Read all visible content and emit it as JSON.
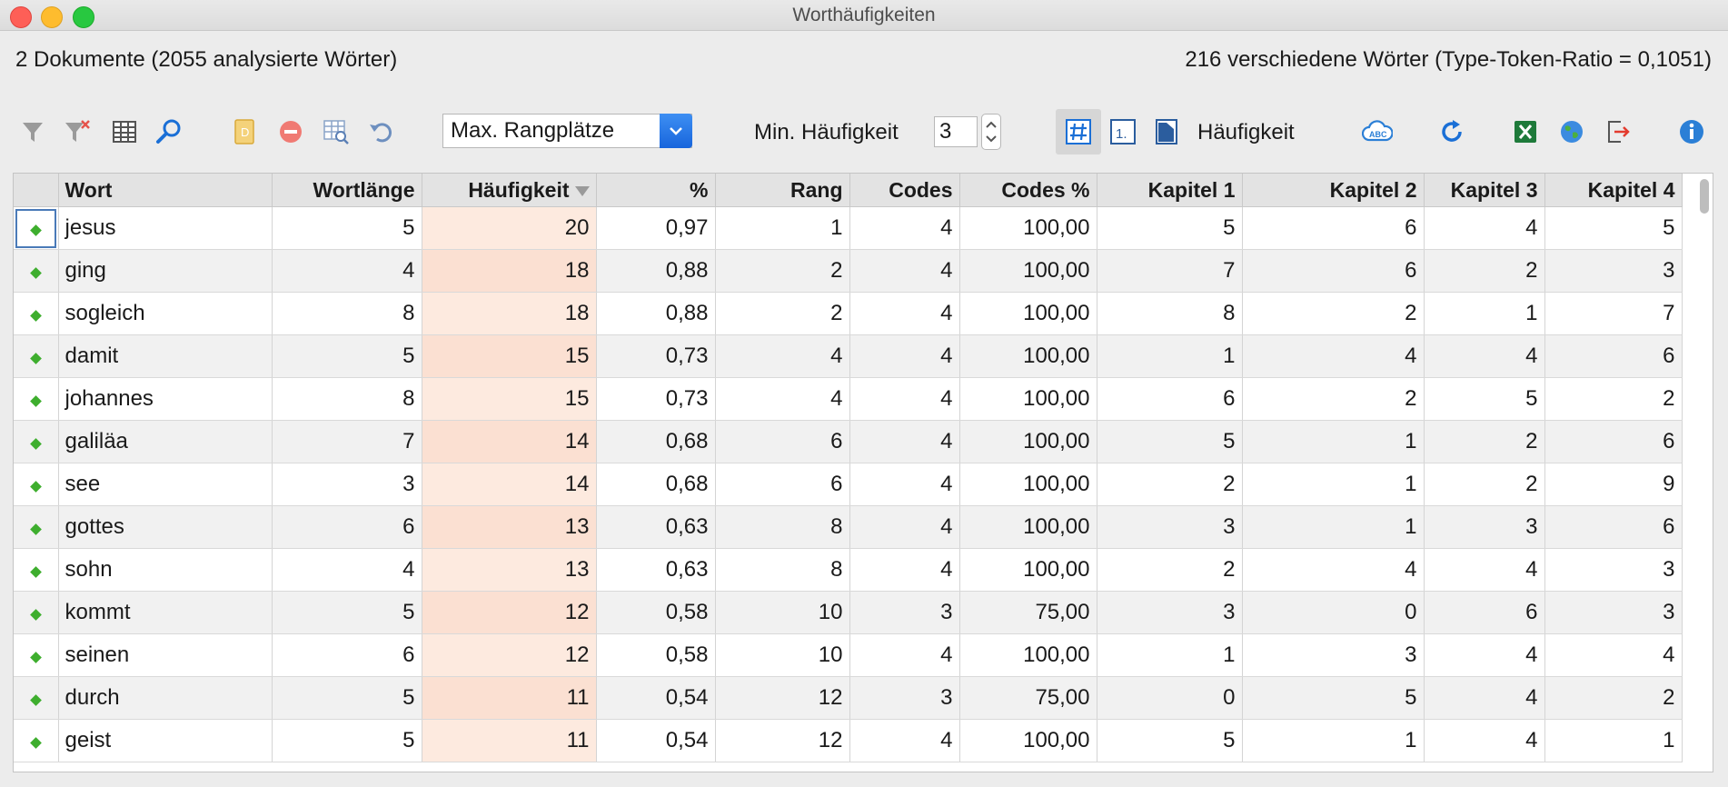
{
  "window": {
    "title": "Worthäufigkeiten"
  },
  "summary": {
    "left": "2 Dokumente (2055 analysierte Wörter)",
    "right": "216 verschiedene Wörter (Type-Token-Ratio = 0,1051)"
  },
  "toolbar": {
    "select_value": "Max. Rangplätze",
    "min_label": "Min. Häufigkeit",
    "min_value": "3",
    "view_label": "Häufigkeit",
    "icons": [
      "filter-icon",
      "clear-filter-icon",
      "columns-icon",
      "search-icon",
      "document-icon",
      "remove-icon",
      "table-search-icon",
      "undo-icon",
      "hash-view-icon",
      "rank-view-icon",
      "document-view-icon",
      "word-cloud-icon",
      "refresh-icon",
      "excel-icon",
      "web-export-icon",
      "export-icon",
      "info-icon"
    ],
    "colors": {
      "accent": "#1a6fd6",
      "excel": "#1e7a3a",
      "remove": "#e5534b"
    }
  },
  "table": {
    "columns": [
      "",
      "Wort",
      "Wortlänge",
      "Häufigkeit",
      "%",
      "Rang",
      "Codes",
      "Codes %",
      "Kapitel 1",
      "Kapitel 2",
      "Kapitel 3",
      "Kapitel 4"
    ],
    "sorted_column": "Häufigkeit",
    "highlight_color": "#fdeadf",
    "rows": [
      [
        "jesus",
        "5",
        "20",
        "0,97",
        "1",
        "4",
        "100,00",
        "5",
        "6",
        "4",
        "5"
      ],
      [
        "ging",
        "4",
        "18",
        "0,88",
        "2",
        "4",
        "100,00",
        "7",
        "6",
        "2",
        "3"
      ],
      [
        "sogleich",
        "8",
        "18",
        "0,88",
        "2",
        "4",
        "100,00",
        "8",
        "2",
        "1",
        "7"
      ],
      [
        "damit",
        "5",
        "15",
        "0,73",
        "4",
        "4",
        "100,00",
        "1",
        "4",
        "4",
        "6"
      ],
      [
        "johannes",
        "8",
        "15",
        "0,73",
        "4",
        "4",
        "100,00",
        "6",
        "2",
        "5",
        "2"
      ],
      [
        "galiläa",
        "7",
        "14",
        "0,68",
        "6",
        "4",
        "100,00",
        "5",
        "1",
        "2",
        "6"
      ],
      [
        "see",
        "3",
        "14",
        "0,68",
        "6",
        "4",
        "100,00",
        "2",
        "1",
        "2",
        "9"
      ],
      [
        "gottes",
        "6",
        "13",
        "0,63",
        "8",
        "4",
        "100,00",
        "3",
        "1",
        "3",
        "6"
      ],
      [
        "sohn",
        "4",
        "13",
        "0,63",
        "8",
        "4",
        "100,00",
        "2",
        "4",
        "4",
        "3"
      ],
      [
        "kommt",
        "5",
        "12",
        "0,58",
        "10",
        "3",
        "75,00",
        "3",
        "0",
        "6",
        "3"
      ],
      [
        "seinen",
        "6",
        "12",
        "0,58",
        "10",
        "4",
        "100,00",
        "1",
        "3",
        "4",
        "4"
      ],
      [
        "durch",
        "5",
        "11",
        "0,54",
        "12",
        "3",
        "75,00",
        "0",
        "5",
        "4",
        "2"
      ],
      [
        "geist",
        "5",
        "11",
        "0,54",
        "12",
        "4",
        "100,00",
        "5",
        "1",
        "4",
        "1"
      ]
    ]
  }
}
